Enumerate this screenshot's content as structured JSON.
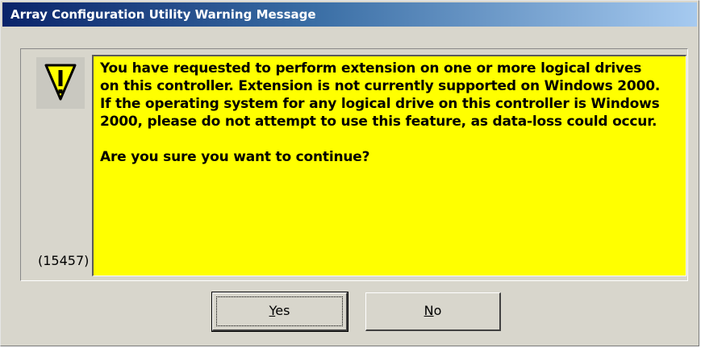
{
  "window": {
    "title": "Array Configuration Utility Warning Message"
  },
  "icon": {
    "name": "warning-icon",
    "glyph": "!",
    "color": "#ffff00"
  },
  "message": {
    "lines": [
      "You have requested to perform extension on one or more logical drives",
      "on this controller. Extension is not currently supported on Windows 2000.",
      "If the operating system for any logical drive on this controller is Windows",
      "2000, please do not attempt to use this feature, as data-loss could occur."
    ],
    "question": "Are you sure you want to continue?",
    "background": "#ffff00"
  },
  "error_code": "(15457)",
  "buttons": {
    "yes": {
      "mnemonic": "Y",
      "rest": "es"
    },
    "no": {
      "mnemonic": "N",
      "rest": "o"
    }
  }
}
